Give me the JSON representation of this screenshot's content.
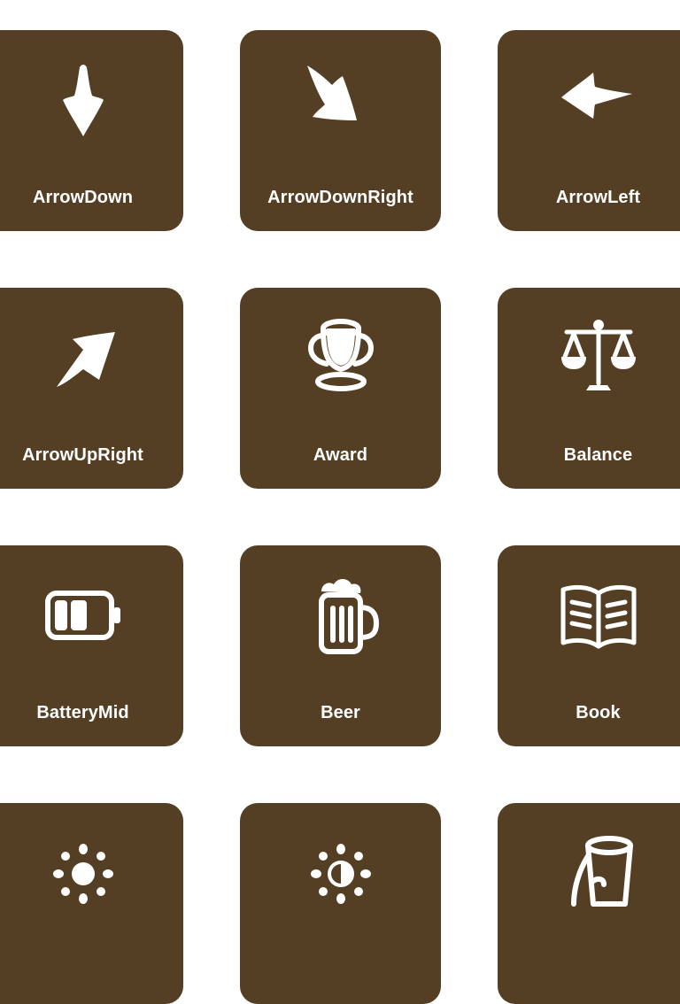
{
  "colors": {
    "tile_background": "#553f24",
    "icon_foreground": "#ffffff",
    "page_background": "#ffffff"
  },
  "icons": [
    {
      "label": "ArrowDown",
      "icon": "arrow-down-icon"
    },
    {
      "label": "ArrowDownRight",
      "icon": "arrow-down-right-icon"
    },
    {
      "label": "ArrowLeft",
      "icon": "arrow-left-icon"
    },
    {
      "label": "ArrowUpRight",
      "icon": "arrow-up-right-icon"
    },
    {
      "label": "Award",
      "icon": "award-icon"
    },
    {
      "label": "Balance",
      "icon": "balance-icon"
    },
    {
      "label": "BatteryMid",
      "icon": "battery-mid-icon"
    },
    {
      "label": "Beer",
      "icon": "beer-icon"
    },
    {
      "label": "Book",
      "icon": "book-icon"
    },
    {
      "label": "",
      "icon": "brightness-icon"
    },
    {
      "label": "",
      "icon": "brightness-half-icon"
    },
    {
      "label": "",
      "icon": "bucket-icon"
    }
  ]
}
